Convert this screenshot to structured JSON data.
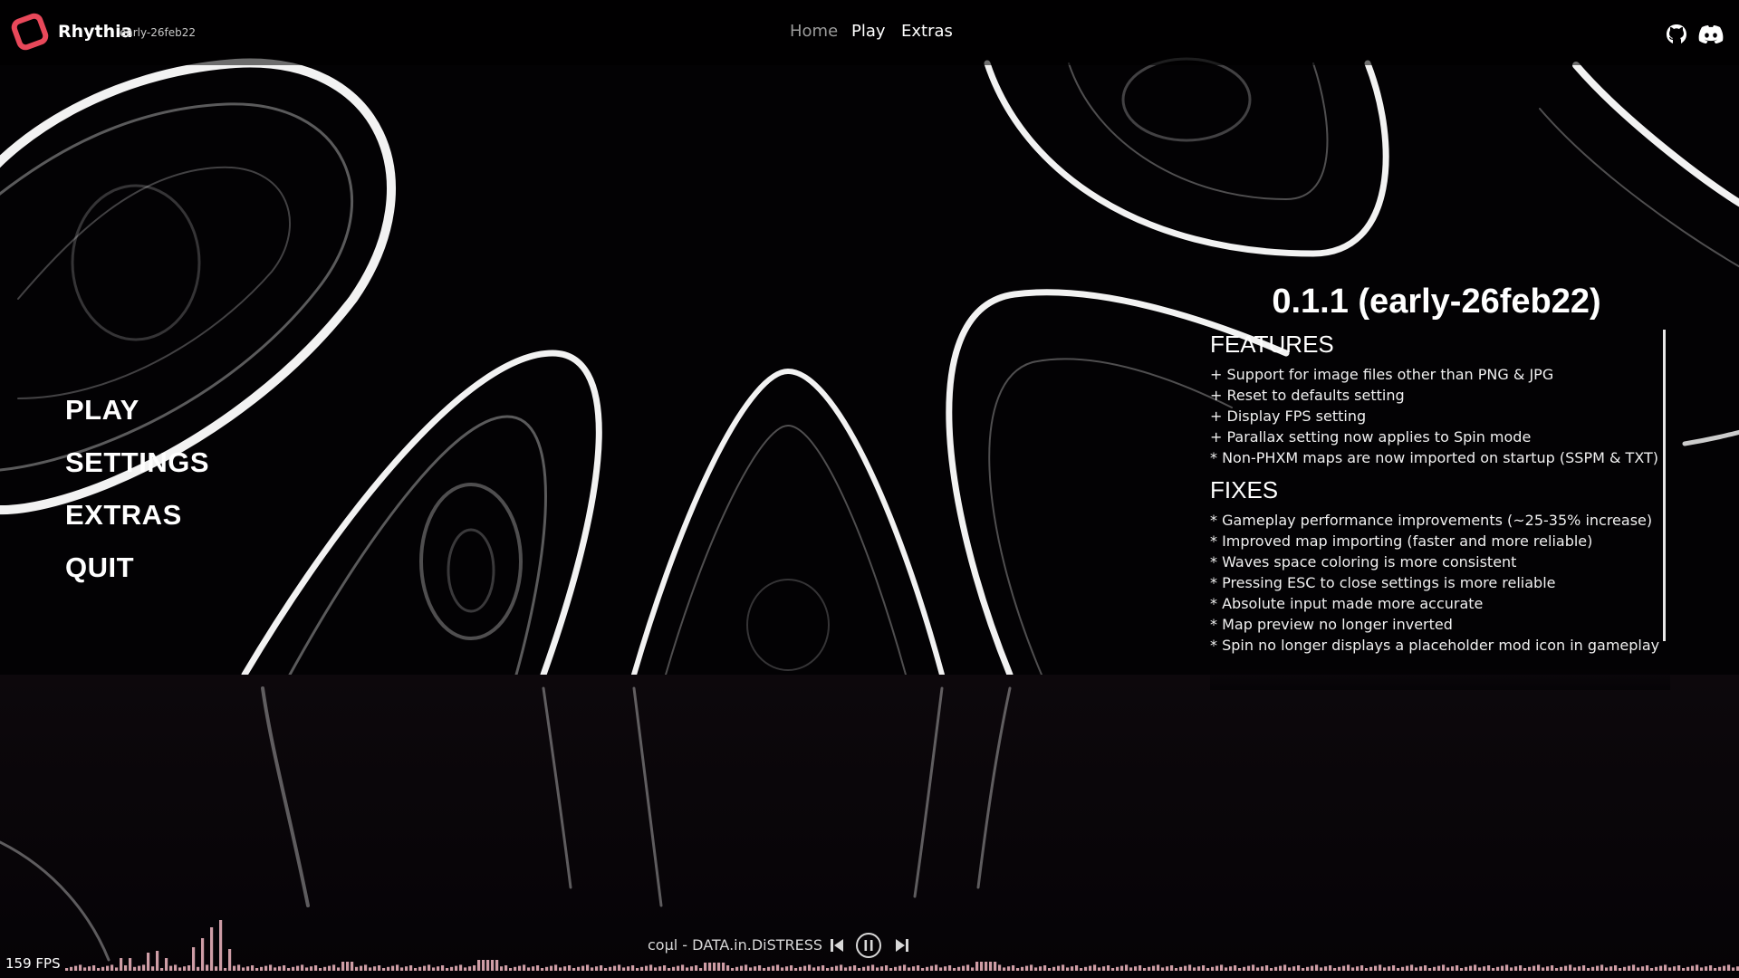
{
  "app": {
    "name": "Rhythia",
    "version": "early-26feb22"
  },
  "nav": {
    "home": "Home",
    "play": "Play",
    "extras": "Extras"
  },
  "icons": {
    "logo": "rhythia-logo",
    "github": "github-icon",
    "discord": "discord-icon"
  },
  "menu": {
    "play": "PLAY",
    "settings": "SETTINGS",
    "extras": "EXTRAS",
    "quit": "QUIT"
  },
  "changelog": {
    "title": "0.1.1 (early-26feb22)",
    "features_heading": "FEATURES",
    "features": [
      "+ Support for image files other than PNG & JPG",
      "+ Reset to defaults setting",
      "+ Display FPS setting",
      "+ Parallax setting now applies to Spin mode",
      "* Non-PHXM maps are now imported on startup (SSPM & TXT)"
    ],
    "fixes_heading": "FIXES",
    "fixes": [
      "* Gameplay performance improvements (~25-35% increase)",
      "* Improved map importing (faster and more reliable)",
      "* Waves space coloring is more consistent",
      "* Pressing ESC to close settings is more reliable",
      "* Absolute input made more accurate",
      "* Map preview no longer inverted",
      "* Spin no longer displays a placeholder mod icon in gameplay"
    ]
  },
  "footer": {
    "fps": "159 FPS",
    "now_playing": "coµl - DATA.in.DiSTRESS"
  },
  "colors": {
    "accent": "#e8485a",
    "bar": "#f2b8c2",
    "background": "#050306"
  }
}
